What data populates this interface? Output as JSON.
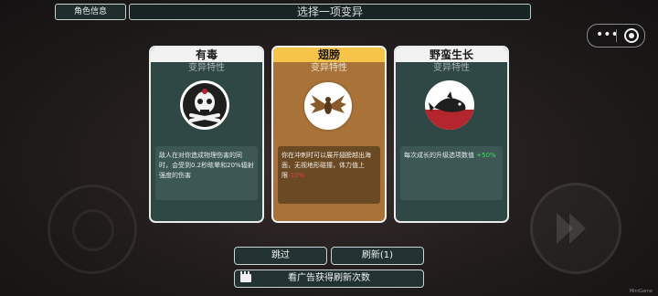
{
  "header": {
    "character_info_label": "角色信息",
    "title": "选择一项变异"
  },
  "cards": [
    {
      "name": "有毒",
      "subtitle": "变异特性",
      "icon": "skull-crossbones-icon",
      "desc_text": "敌人在对你造成物理伤害的同时，会受到0.2秒眩晕和20%辐射强度的伤害",
      "desc_highlight": ""
    },
    {
      "name": "翅膀",
      "subtitle": "变异特性",
      "icon": "wings-icon",
      "desc_text": "你在冲刺时可以展开翅膀越出海面，无视地形碰撞，体力值上限",
      "desc_highlight": "-10%",
      "selected": true
    },
    {
      "name": "野蛮生长",
      "subtitle": "变异特性",
      "icon": "fish-growth-icon",
      "desc_text": "每次成长的升级选项数值 ",
      "desc_highlight": "+50%"
    }
  ],
  "buttons": {
    "skip": "跳过",
    "refresh": "刷新(1)",
    "watch_ad": "看广告获得刷新次数"
  },
  "watermark": "MiniGame",
  "colors": {
    "selected_card": "#a87238",
    "selected_header": "#f5c449",
    "card_bg": "#2f4745",
    "positive": "#4fd46a",
    "negative": "#e83a3a"
  }
}
